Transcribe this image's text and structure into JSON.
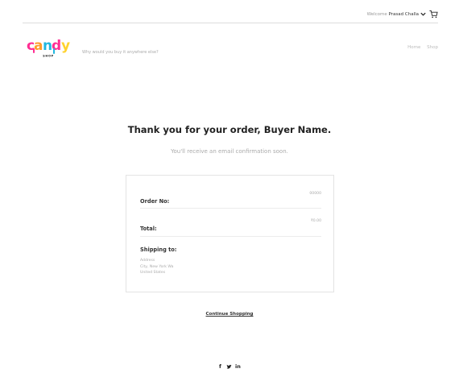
{
  "header": {
    "welcome_prefix": "Welcome",
    "user_name": "Prasad Challa"
  },
  "brand": {
    "logo_text": "candy",
    "logo_sub": "SHOP",
    "tagline": "Why would you buy it anywhere else?"
  },
  "nav": {
    "items": [
      "Home",
      "Shop"
    ]
  },
  "main": {
    "title": "Thank you for your order, Buyer Name.",
    "subtitle": "You'll receive an email confirmation soon."
  },
  "order": {
    "order_no_label": "Order No:",
    "order_no_value": "00000",
    "total_label": "Total:",
    "total_value": "₹0.00",
    "shipping_label": "Shipping to:",
    "address_lines": [
      "Address",
      "City, New York Wa",
      "United States"
    ]
  },
  "footer": {
    "continue_label": "Continue Shopping",
    "social_icons": [
      "facebook-icon",
      "twitter-icon",
      "linkedin-icon"
    ]
  },
  "colors": {
    "logo_pink": "#ff2e93",
    "logo_orange": "#ff9c2a",
    "logo_cyan": "#1fb7e0",
    "logo_yellow": "#ffd22e"
  }
}
